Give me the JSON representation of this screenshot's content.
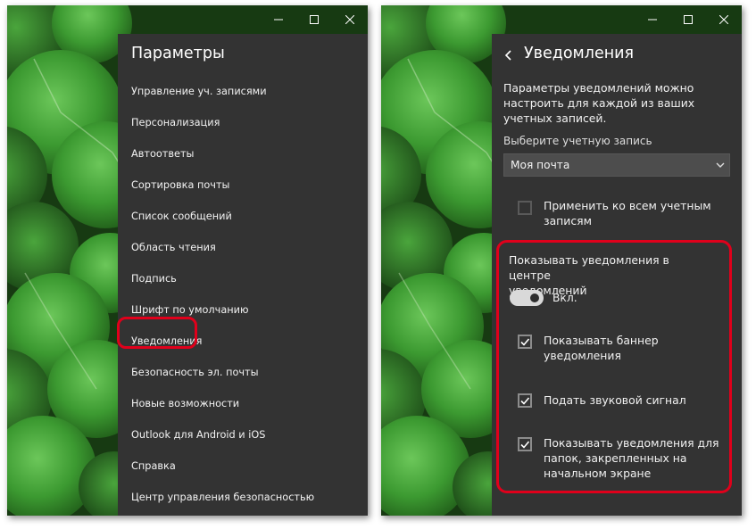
{
  "colors": {
    "panel_bg": "#333333",
    "text": "#ffffff",
    "highlight": "#e0001b",
    "background_green": "#3f9b35"
  },
  "left_window": {
    "title_buttons": [
      "minimize-icon",
      "maximize-icon",
      "close-icon"
    ],
    "title": "Параметры",
    "items": [
      {
        "label": "Управление уч. записями"
      },
      {
        "label": "Персонализация"
      },
      {
        "label": "Автоответы"
      },
      {
        "label": "Сортировка почты"
      },
      {
        "label": "Список сообщений"
      },
      {
        "label": "Область чтения"
      },
      {
        "label": "Подпись"
      },
      {
        "label": "Шрифт по умолчанию"
      },
      {
        "label": "Уведомления"
      },
      {
        "label": "Безопасность эл. почты"
      },
      {
        "label": "Новые возможности"
      },
      {
        "label": "Outlook для Android и iOS"
      },
      {
        "label": "Справка"
      },
      {
        "label": "Центр управления безопасностью"
      }
    ]
  },
  "right_window": {
    "title_buttons": [
      "minimize-icon",
      "maximize-icon",
      "close-icon"
    ],
    "title": "Уведомления",
    "description": "Параметры уведомлений можно настроить для каждой из ваших учетных записей.",
    "choose_account_label": "Выберите учетную запись",
    "account_select": {
      "value": "Моя почта"
    },
    "apply_all": {
      "label_line1": "Применить ко всем учетным",
      "label_line2": "записям",
      "checked": false
    },
    "show_in_center": {
      "label_line1": "Показывать уведомления в центре",
      "label_line2": "уведомлений"
    },
    "toggle": {
      "state_label": "Вкл.",
      "on": true
    },
    "banner": {
      "label_line1": "Показывать баннер",
      "label_line2": "уведомления",
      "checked": true
    },
    "sound": {
      "label": "Подать звуковой сигнал",
      "checked": true
    },
    "pinned": {
      "label_line1": "Показывать уведомления для",
      "label_line2": "папок, закрепленных на",
      "label_line3": "начальном экране",
      "checked": true
    }
  }
}
